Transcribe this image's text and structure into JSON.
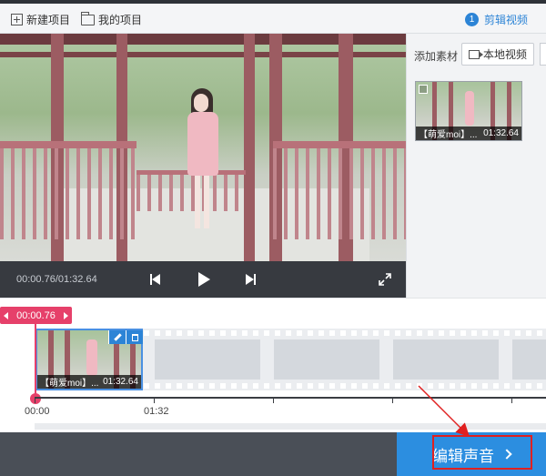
{
  "toolbar": {
    "new_project": "新建项目",
    "my_projects": "我的项目",
    "step_number": "1",
    "step_label": "剪辑视频"
  },
  "player": {
    "time": "00:00.76/01:32.64"
  },
  "materials": {
    "add_label": "添加素材",
    "local_video_button": "本地视频",
    "items": [
      {
        "title": "【萌爱moi】...",
        "duration": "01:32.64"
      }
    ]
  },
  "timeline": {
    "cursor_time": "00:00.76",
    "clip": {
      "title": "【萌爱moi】...",
      "duration": "01:32.64"
    },
    "ruler_labels": [
      "00:00",
      "01:32"
    ]
  },
  "footer": {
    "next_button": "编辑声音"
  },
  "colors": {
    "accent": "#2c8ee0",
    "playhead": "#e6406a",
    "annotation": "#e02020"
  },
  "icons": [
    "plus-box-icon",
    "folder-icon",
    "prev-icon",
    "play-icon",
    "next-icon",
    "fullscreen-icon",
    "video-add-icon",
    "edit-icon",
    "delete-icon",
    "chevron-right-icon"
  ]
}
